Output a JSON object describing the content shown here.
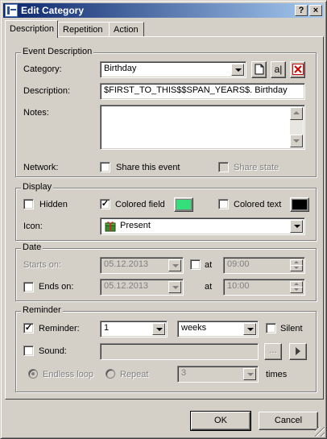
{
  "window": {
    "title": "Edit Category",
    "help_glyph": "?",
    "close_glyph": "×"
  },
  "tabs": [
    {
      "label": "Description",
      "active": true
    },
    {
      "label": "Repetition",
      "active": false
    },
    {
      "label": "Action",
      "active": false
    }
  ],
  "event_description": {
    "title": "Event Description",
    "category_label": "Category:",
    "category_value": "Birthday",
    "btn_new_glyph": "",
    "btn_rename_glyph": "a|",
    "btn_delete_glyph": "✕",
    "description_label": "Description:",
    "description_value": "$FIRST_TO_THIS$$SPAN_YEARS$. Birthday",
    "notes_label": "Notes:",
    "notes_value": "",
    "network_label": "Network:",
    "share_event_label": "Share this event",
    "share_event_checked": false,
    "share_state_label": "Share state",
    "share_state_checked": false
  },
  "display": {
    "title": "Display",
    "hidden_label": "Hidden",
    "hidden_checked": false,
    "colored_field_label": "Colored field",
    "colored_field_checked": true,
    "colored_field_color": "#33e07a",
    "colored_text_label": "Colored text",
    "colored_text_checked": false,
    "colored_text_color": "#000000",
    "icon_label": "Icon:",
    "icon_value": "Present",
    "icon_name": "present-icon"
  },
  "date": {
    "title": "Date",
    "starts_label": "Starts on:",
    "starts_value": "05.12.2013",
    "starts_at_checked": false,
    "at_label": "at",
    "starts_time": "09:00",
    "ends_label": "Ends on:",
    "ends_checked": false,
    "ends_value": "05.12.2013",
    "ends_time": "10:00"
  },
  "reminder": {
    "title": "Reminder",
    "reminder_label": "Reminder:",
    "reminder_checked": true,
    "amount_value": "1",
    "unit_value": "weeks",
    "silent_label": "Silent",
    "silent_checked": false,
    "sound_label": "Sound:",
    "sound_checked": false,
    "sound_value": "",
    "browse_label": "...",
    "endless_loop_label": "Endless loop",
    "repeat_label": "Repeat",
    "repeat_value": "3",
    "times_label": "times"
  },
  "buttons": {
    "ok_label": "OK",
    "cancel_label": "Cancel"
  }
}
